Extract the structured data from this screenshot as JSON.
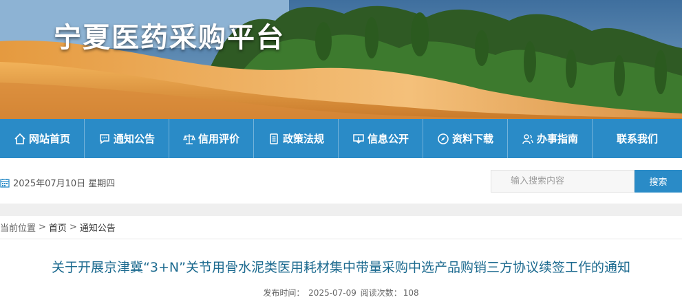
{
  "site": {
    "title": "宁夏医药采购平台"
  },
  "nav": {
    "items": [
      {
        "label": "网站首页",
        "icon": "home-icon"
      },
      {
        "label": "通知公告",
        "icon": "chat-bubble-icon"
      },
      {
        "label": "信用评价",
        "icon": "balance-scale-icon"
      },
      {
        "label": "政策法规",
        "icon": "document-list-icon"
      },
      {
        "label": "信息公开",
        "icon": "monitor-download-icon"
      },
      {
        "label": "资料下载",
        "icon": "compass-icon"
      },
      {
        "label": "办事指南",
        "icon": "users-icon"
      },
      {
        "label": "联系我们",
        "icon": ""
      }
    ]
  },
  "utility": {
    "date": "2025年07月10日 星期四",
    "search_placeholder": "输入搜索内容",
    "search_button": "搜索"
  },
  "breadcrumb": {
    "label": "当前位置",
    "items": [
      "首页",
      "通知公告"
    ]
  },
  "article": {
    "title": "关于开展京津冀“3+N”关节用骨水泥类医用耗材集中带量采购中选产品购销三方协议续签工作的通知",
    "publish_label": "发布时间：",
    "publish_date": "2025-07-09",
    "views_label": "阅读次数：",
    "views": "108"
  },
  "colors": {
    "nav_bg": "#2a8bc7",
    "title_text": "#1c6a8f",
    "button_bg": "#2a8bc7"
  }
}
